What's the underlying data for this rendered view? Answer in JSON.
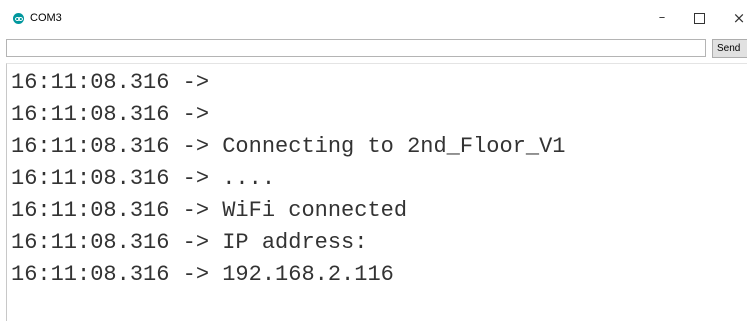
{
  "window": {
    "title": "COM3",
    "minimize": "–",
    "close": "×"
  },
  "input_row": {
    "value": "",
    "send_label": "Send"
  },
  "serial_output": [
    "16:11:08.316 -> ",
    "16:11:08.316 -> ",
    "16:11:08.316 -> Connecting to 2nd_Floor_V1",
    "16:11:08.316 -> ....",
    "16:11:08.316 -> WiFi connected",
    "16:11:08.316 -> IP address: ",
    "16:11:08.316 -> 192.168.2.116"
  ],
  "colors": {
    "app_icon": "#00979d",
    "text": "#333333"
  }
}
